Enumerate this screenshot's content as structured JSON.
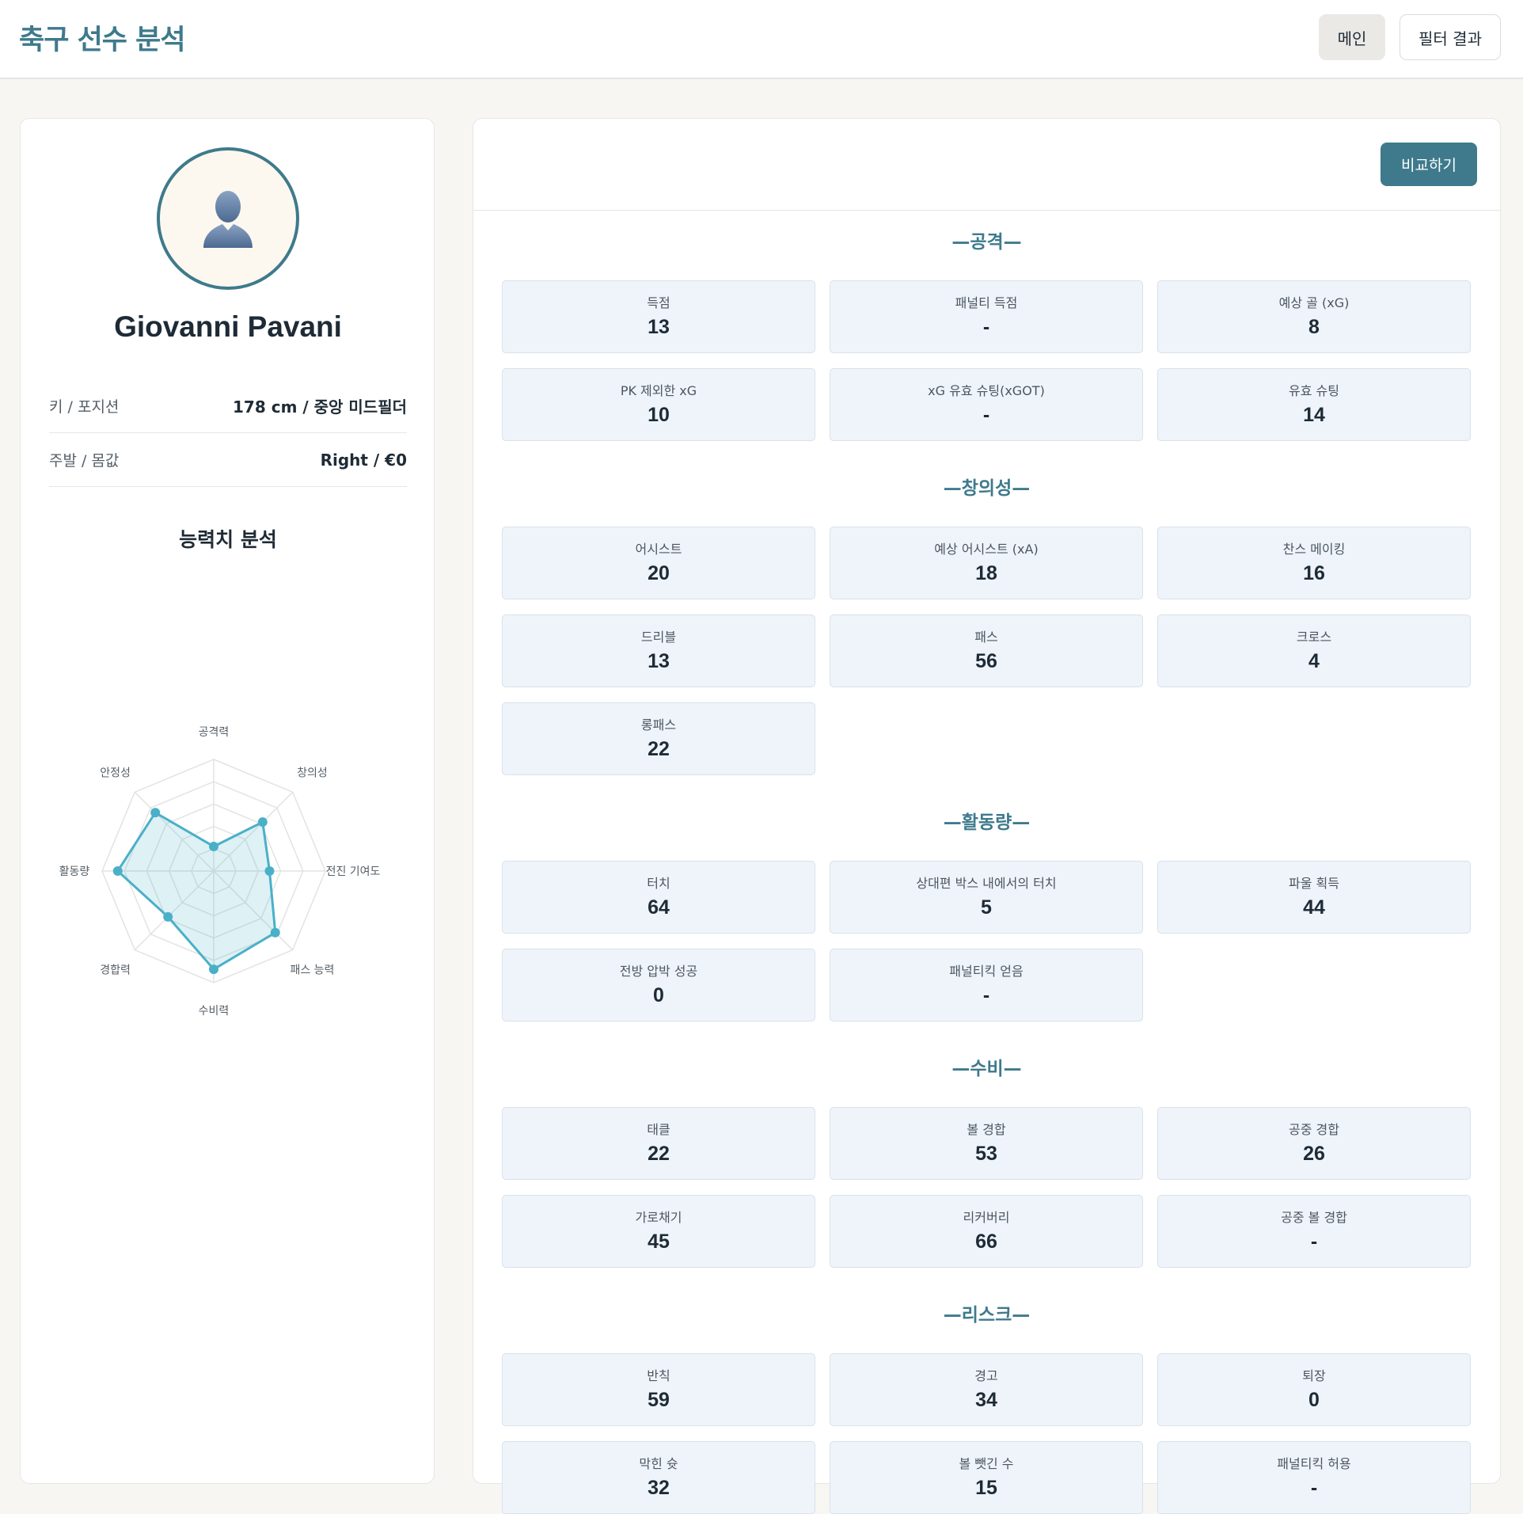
{
  "header": {
    "title": "축구 선수 분석",
    "nav": {
      "main_label": "메인",
      "filter_label": "필터 결과"
    }
  },
  "profile": {
    "name": "Giovanni Pavani",
    "rows": [
      {
        "label": "키 / 포지션",
        "value": "178 cm / 중앙 미드필더"
      },
      {
        "label": "주발 / 몸값",
        "value": "Right / €0"
      }
    ],
    "ability_title": "능력치 분석"
  },
  "radar": {
    "axes": [
      "공격력",
      "창의성",
      "전진 기여도",
      "패스 능력",
      "수비력",
      "경합력",
      "활동량",
      "안정성"
    ],
    "values": [
      0.22,
      0.62,
      0.5,
      0.78,
      0.88,
      0.58,
      0.86,
      0.74
    ],
    "color": "#4ab0c8"
  },
  "actions": {
    "compare_label": "비교하기"
  },
  "categories": [
    {
      "title": "—공격—",
      "stats": [
        {
          "label": "득점",
          "value": "13"
        },
        {
          "label": "패널티 득점",
          "value": "-"
        },
        {
          "label": "예상 골 (xG)",
          "value": "8"
        },
        {
          "label": "PK 제외한 xG",
          "value": "10"
        },
        {
          "label": "xG 유효 슈팅(xGOT)",
          "value": "-"
        },
        {
          "label": "유효 슈팅",
          "value": "14"
        }
      ]
    },
    {
      "title": "—창의성—",
      "stats": [
        {
          "label": "어시스트",
          "value": "20"
        },
        {
          "label": "예상 어시스트 (xA)",
          "value": "18"
        },
        {
          "label": "찬스 메이킹",
          "value": "16"
        },
        {
          "label": "드리블",
          "value": "13"
        },
        {
          "label": "패스",
          "value": "56"
        },
        {
          "label": "크로스",
          "value": "4"
        },
        {
          "label": "롱패스",
          "value": "22"
        }
      ]
    },
    {
      "title": "—활동량—",
      "stats": [
        {
          "label": "터치",
          "value": "64"
        },
        {
          "label": "상대편 박스 내에서의 터치",
          "value": "5"
        },
        {
          "label": "파울 획득",
          "value": "44"
        },
        {
          "label": "전방 압박 성공",
          "value": "0"
        },
        {
          "label": "패널티킥 얻음",
          "value": "-"
        }
      ]
    },
    {
      "title": "—수비—",
      "stats": [
        {
          "label": "태클",
          "value": "22"
        },
        {
          "label": "볼 경합",
          "value": "53"
        },
        {
          "label": "공중 경합",
          "value": "26"
        },
        {
          "label": "가로채기",
          "value": "45"
        },
        {
          "label": "리커버리",
          "value": "66"
        },
        {
          "label": "공중 볼 경합",
          "value": "-"
        }
      ]
    },
    {
      "title": "—리스크—",
      "stats": [
        {
          "label": "반칙",
          "value": "59"
        },
        {
          "label": "경고",
          "value": "34"
        },
        {
          "label": "퇴장",
          "value": "0"
        },
        {
          "label": "막힌 슛",
          "value": "32"
        },
        {
          "label": "볼 뺏긴 수",
          "value": "15"
        },
        {
          "label": "패널티킥 허용",
          "value": "-"
        }
      ]
    }
  ]
}
